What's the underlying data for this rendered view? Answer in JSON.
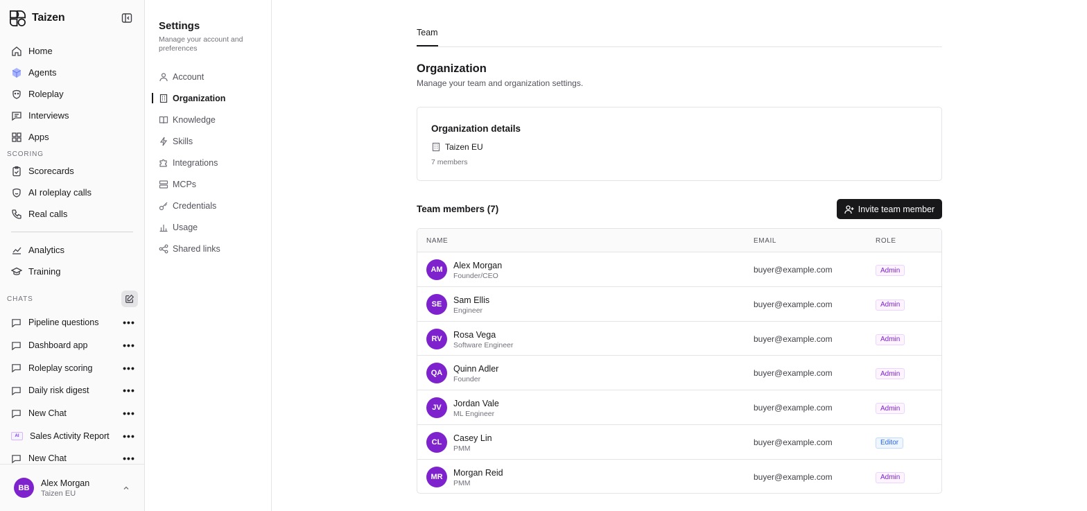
{
  "sidebar": {
    "brand": "Taizen",
    "nav": [
      {
        "label": "Home",
        "icon": "home-icon"
      },
      {
        "label": "Agents",
        "icon": "cube-icon"
      },
      {
        "label": "Roleplay",
        "icon": "roleplay-icon"
      },
      {
        "label": "Interviews",
        "icon": "interviews-icon"
      },
      {
        "label": "Apps",
        "icon": "apps-icon"
      }
    ],
    "scoring_label": "SCORING",
    "scoring": [
      {
        "label": "Scorecards",
        "icon": "clipboard-icon"
      },
      {
        "label": "AI roleplay calls",
        "icon": "ai-call-icon"
      },
      {
        "label": "Real calls",
        "icon": "phone-icon"
      }
    ],
    "tools": [
      {
        "label": "Analytics",
        "icon": "chart-icon"
      },
      {
        "label": "Training",
        "icon": "graduation-icon"
      }
    ],
    "chats_label": "CHATS",
    "chats": [
      {
        "title": "Pipeline questions",
        "ai": false
      },
      {
        "title": "Dashboard app",
        "ai": false
      },
      {
        "title": "Roleplay scoring",
        "ai": false
      },
      {
        "title": "Daily risk digest",
        "ai": false
      },
      {
        "title": "New Chat",
        "ai": false
      },
      {
        "title": "Sales Activity Report",
        "ai": true,
        "badge": "AI"
      },
      {
        "title": "New Chat",
        "ai": false
      }
    ],
    "more_glyph": "•••",
    "user": {
      "initials": "BB",
      "name": "Alex Morgan",
      "org": "Taizen EU"
    }
  },
  "settings": {
    "title": "Settings",
    "subtitle": "Manage your account and preferences",
    "items": [
      {
        "label": "Account",
        "active": false
      },
      {
        "label": "Organization",
        "active": true
      },
      {
        "label": "Knowledge",
        "active": false
      },
      {
        "label": "Skills",
        "active": false
      },
      {
        "label": "Integrations",
        "active": false
      },
      {
        "label": "MCPs",
        "active": false
      },
      {
        "label": "Credentials",
        "active": false
      },
      {
        "label": "Usage",
        "active": false
      },
      {
        "label": "Shared links",
        "active": false
      }
    ]
  },
  "main": {
    "tab": "Team",
    "title": "Organization",
    "subtitle": "Manage your team and organization settings.",
    "org_card": {
      "title": "Organization details",
      "name": "Taizen EU",
      "members": "7 members"
    },
    "members_title": "Team members (7)",
    "invite_label": "Invite team member",
    "columns": {
      "name": "NAME",
      "email": "EMAIL",
      "role": "ROLE"
    },
    "members": [
      {
        "initials": "AM",
        "name": "Alex Morgan",
        "title": "Founder/CEO",
        "email": "buyer@example.com",
        "role": "Admin"
      },
      {
        "initials": "SE",
        "name": "Sam Ellis",
        "title": "Engineer",
        "email": "buyer@example.com",
        "role": "Admin"
      },
      {
        "initials": "RV",
        "name": "Rosa Vega",
        "title": "Software Engineer",
        "email": "buyer@example.com",
        "role": "Admin"
      },
      {
        "initials": "QA",
        "name": "Quinn Adler",
        "title": "Founder",
        "email": "buyer@example.com",
        "role": "Admin"
      },
      {
        "initials": "JV",
        "name": "Jordan Vale",
        "title": "ML Engineer",
        "email": "buyer@example.com",
        "role": "Admin"
      },
      {
        "initials": "CL",
        "name": "Casey Lin",
        "title": "PMM",
        "email": "buyer@example.com",
        "role": "Editor"
      },
      {
        "initials": "MR",
        "name": "Morgan Reid",
        "title": "PMM",
        "email": "buyer@example.com",
        "role": "Admin"
      }
    ]
  },
  "colors": {
    "accent": "#7e22ce",
    "primary_button": "#18181b",
    "admin": "#7e22ce",
    "editor": "#2563eb"
  }
}
